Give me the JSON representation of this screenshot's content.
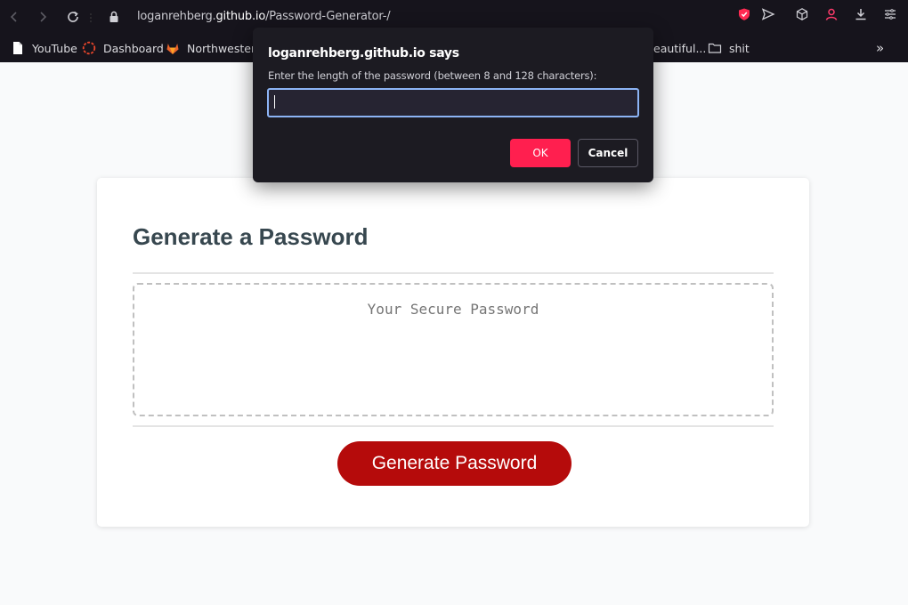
{
  "browser": {
    "url_prefix": "loganrehberg.",
    "url_host": "github.io",
    "url_path": "/Password-Generator-/",
    "bookmarks": [
      {
        "label": "YouTube",
        "icon": "file-icon"
      },
      {
        "label": "Dashboard",
        "icon": "dashboard-icon"
      },
      {
        "label": "Northwestern",
        "icon": "gitlab-icon"
      },
      {
        "label": "eautiful...",
        "icon": "bookmark-icon"
      },
      {
        "label": "shit",
        "icon": "folder-icon"
      }
    ],
    "overflow_label": "»"
  },
  "dialog": {
    "title": "loganrehberg.github.io says",
    "message": "Enter the length of the password (between 8 and 128 characters):",
    "input_value": "",
    "ok_label": "OK",
    "cancel_label": "Cancel"
  },
  "page": {
    "title": "Generate a Password",
    "password_placeholder": "Your Secure Password",
    "generate_label": "Generate Password"
  },
  "colors": {
    "accent_ok": "#ff1f4f",
    "generate_button": "#b50b0b",
    "heading": "#37474f"
  }
}
